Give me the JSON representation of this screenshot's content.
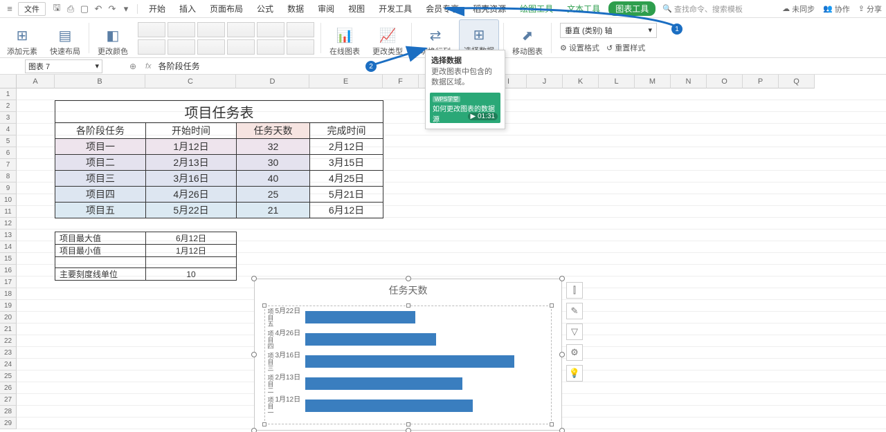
{
  "menubar": {
    "file": "文件",
    "tabs": [
      "开始",
      "插入",
      "页面布局",
      "公式",
      "数据",
      "审阅",
      "视图",
      "开发工具",
      "会员专享",
      "稻壳资源"
    ],
    "context_tabs": [
      "绘图工具",
      "文本工具",
      "图表工具"
    ],
    "search_placeholder": "查找命令、搜索模板",
    "right": {
      "unsynced": "未同步",
      "collab": "协作",
      "share": "分享"
    }
  },
  "ribbon": {
    "add_element": "添加元素",
    "quick_layout": "快速布局",
    "change_color": "更改颜色",
    "online_chart": "在线图表",
    "change_type": "更改类型",
    "switch_rowcol": "切换行列",
    "select_data": "选择数据",
    "move_chart": "移动图表",
    "axis_dropdown": "垂直 (类别) 轴",
    "set_format": "设置格式",
    "reset_style": "重置样式"
  },
  "popover": {
    "title": "选择数据",
    "desc": "更改图表中包含的数据区域。",
    "video_caption": "如何更改图表的数据源",
    "video_tag": "WPS学堂",
    "video_time": "01:31"
  },
  "formula_bar": {
    "name_box": "图表 7",
    "formula": "各阶段任务"
  },
  "columns": [
    "A",
    "B",
    "C",
    "D",
    "E",
    "F",
    "G",
    "H",
    "I",
    "J",
    "K",
    "L",
    "M",
    "N",
    "O",
    "P",
    "Q"
  ],
  "rows_count": 29,
  "table_title": "项目任务表",
  "table_headers": [
    "各阶段任务",
    "开始时间",
    "任务天数",
    "完成时间"
  ],
  "table_rows": [
    {
      "name": "项目一",
      "start": "1月12日",
      "days": "32",
      "end": "2月12日"
    },
    {
      "name": "项目二",
      "start": "2月13日",
      "days": "30",
      "end": "3月15日"
    },
    {
      "name": "项目三",
      "start": "3月16日",
      "days": "40",
      "end": "4月25日"
    },
    {
      "name": "项目四",
      "start": "4月26日",
      "days": "25",
      "end": "5月21日"
    },
    {
      "name": "项目五",
      "start": "5月22日",
      "days": "21",
      "end": "6月12日"
    }
  ],
  "small_table": {
    "r1": [
      "项目最大值",
      "6月12日"
    ],
    "r2": [
      "项目最小值",
      "1月12日"
    ],
    "r4": [
      "主要刻度线单位",
      "10"
    ]
  },
  "annotations": {
    "badge1": "1",
    "badge2": "2"
  },
  "chart_data": {
    "type": "bar",
    "title": "任务天数",
    "orientation": "horizontal",
    "categories": [
      "项目五",
      "项目四",
      "项目三",
      "项目二",
      "项目一"
    ],
    "category_dates": [
      "5月22日",
      "4月26日",
      "3月16日",
      "2月13日",
      "1月12日"
    ],
    "values": [
      21,
      25,
      40,
      30,
      32
    ],
    "xlim": [
      0,
      45
    ],
    "xlabel": "",
    "ylabel": ""
  },
  "chart_side_icons": [
    "chart-elements-icon",
    "style-icon",
    "filter-icon",
    "settings-icon",
    "tips-icon"
  ]
}
